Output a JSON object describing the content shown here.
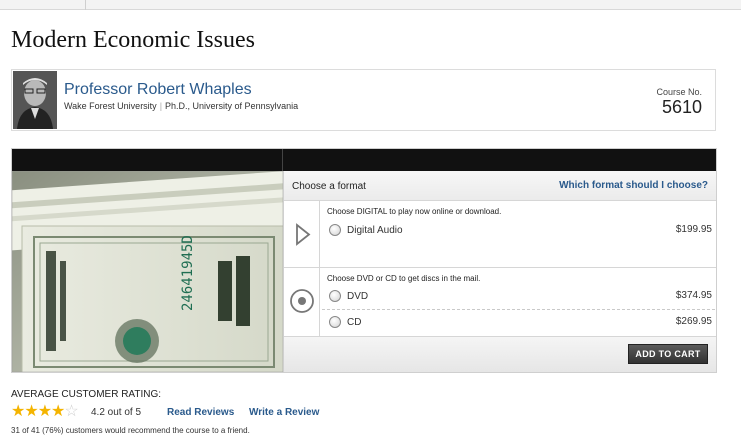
{
  "page": {
    "title": "Modern Economic Issues"
  },
  "professor": {
    "name": "Professor Robert Whaples",
    "university": "Wake Forest University",
    "degree": "Ph.D., University of Pennsylvania",
    "course_label": "Course No.",
    "course_number": "5610"
  },
  "formats": {
    "heading": "Choose a format",
    "help_link": "Which format should I choose?",
    "digital_note": "Choose DIGITAL to play now online or download.",
    "disc_note": "Choose DVD or CD to get discs in the mail.",
    "options": [
      {
        "label": "Digital Audio",
        "price": "$199.95"
      },
      {
        "label": "DVD",
        "price": "$374.95"
      },
      {
        "label": "CD",
        "price": "$269.95"
      }
    ],
    "cart_button": "ADD TO CART"
  },
  "rating": {
    "label": "AVERAGE CUSTOMER RATING:",
    "stars_value": 4.2,
    "stars_max": 5,
    "text": "4.2 out of 5",
    "read_reviews": "Read Reviews",
    "write_review": "Write a Review",
    "recommend": "31 of 41 (76%) customers would recommend the course to a friend."
  },
  "colors": {
    "link": "#2a5a8c",
    "star": "#f4b400",
    "button": "#333333"
  }
}
